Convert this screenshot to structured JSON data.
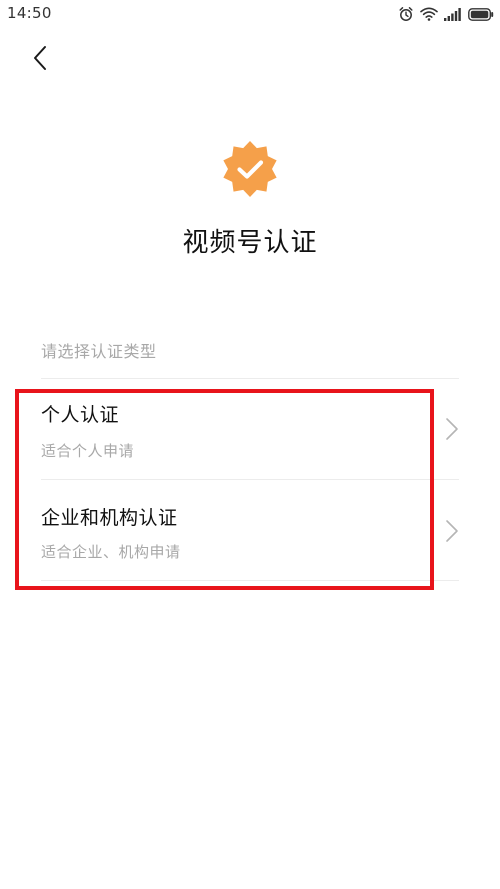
{
  "status_bar": {
    "time": "14:50",
    "icons": [
      "alarm-icon",
      "wifi-icon",
      "signal-icon",
      "battery-icon"
    ]
  },
  "header": {
    "back_icon": "chevron-left-icon"
  },
  "badge": {
    "icon": "verified-badge-icon",
    "color": "#f5a04a"
  },
  "title": "视频号认证",
  "section_hint": "请选择认证类型",
  "options": [
    {
      "title": "个人认证",
      "desc": "适合个人申请"
    },
    {
      "title": "企业和机构认证",
      "desc": "适合企业、机构申请"
    }
  ],
  "colors": {
    "highlight": "#e8141b",
    "secondary_text": "#a8a8a8"
  }
}
